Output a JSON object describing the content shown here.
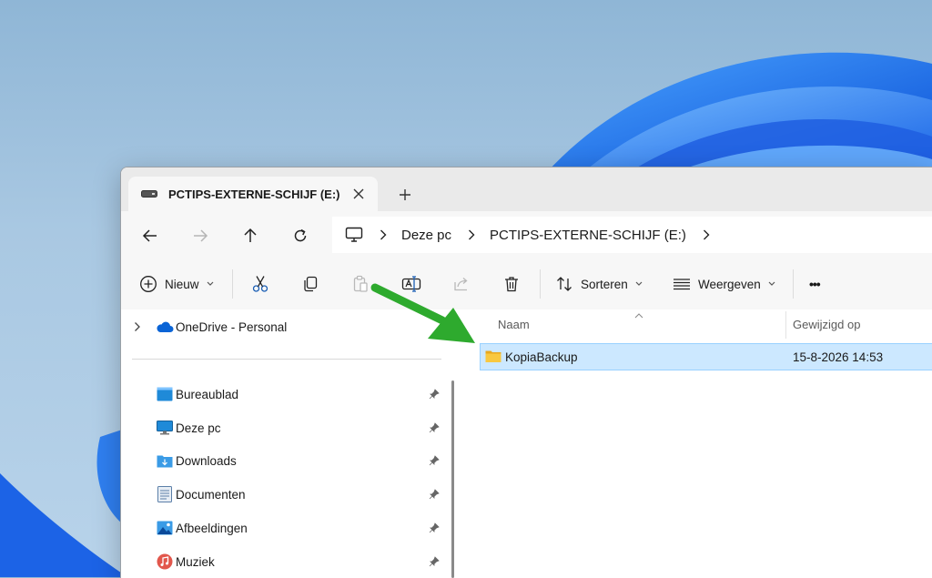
{
  "window": {
    "tab_title": "PCTIPS-EXTERNE-SCHIJF (E:)",
    "new_tab": "+"
  },
  "address": {
    "crumbs": [
      "Deze pc",
      "PCTIPS-EXTERNE-SCHIJF (E:)"
    ]
  },
  "toolbar": {
    "new_label": "Nieuw",
    "sort_label": "Sorteren",
    "view_label": "Weergeven",
    "more_label": "•••"
  },
  "sidebar": {
    "onedrive": "OneDrive - Personal",
    "items": [
      {
        "label": "Bureaublad",
        "icon": "desktop-icon"
      },
      {
        "label": "Deze pc",
        "icon": "monitor-icon"
      },
      {
        "label": "Downloads",
        "icon": "downloads-folder-icon"
      },
      {
        "label": "Documenten",
        "icon": "documents-icon"
      },
      {
        "label": "Afbeeldingen",
        "icon": "pictures-icon"
      },
      {
        "label": "Muziek",
        "icon": "music-icon"
      }
    ]
  },
  "files": {
    "columns": {
      "name": "Naam",
      "modified": "Gewijzigd op"
    },
    "rows": [
      {
        "name": "KopiaBackup",
        "modified": "15-8-2026 14:53",
        "selected": true
      }
    ]
  },
  "colors": {
    "accent": "#0067c0",
    "selection": "#cce8ff",
    "annotation_arrow": "#2eaa2e",
    "folder": "#f8c840"
  }
}
